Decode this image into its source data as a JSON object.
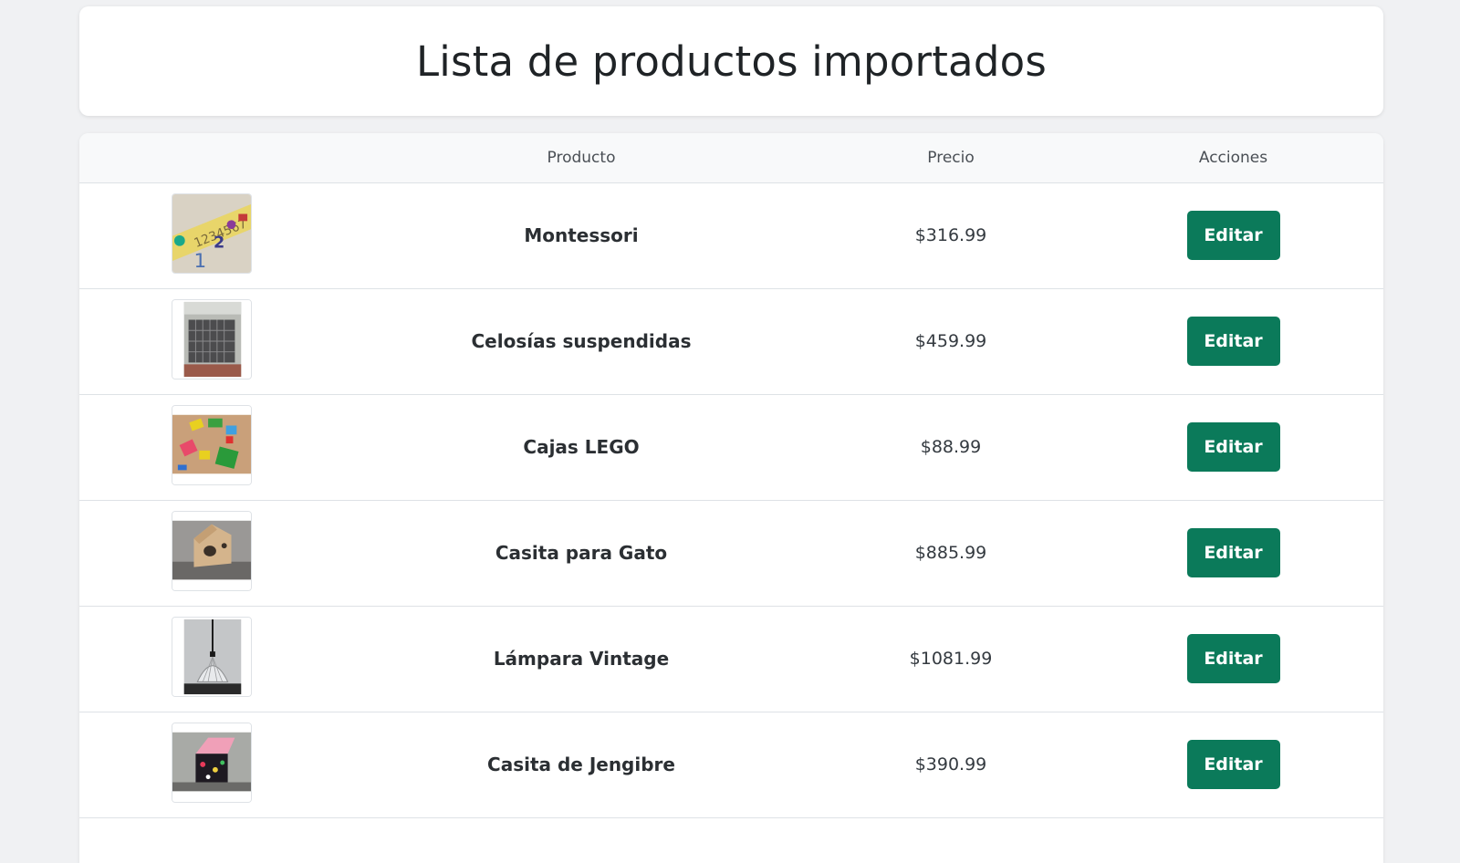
{
  "page": {
    "title": "Lista de productos importados"
  },
  "table": {
    "headers": {
      "image": "",
      "product": "Producto",
      "price": "Precio",
      "actions": "Acciones"
    },
    "rows": [
      {
        "name": "Montessori",
        "price": "$316.99",
        "action_label": "Editar",
        "image_icon": "montessori-numbers-image"
      },
      {
        "name": "Celosías suspendidas",
        "price": "$459.99",
        "action_label": "Editar",
        "image_icon": "hanging-lattice-image"
      },
      {
        "name": "Cajas LEGO",
        "price": "$88.99",
        "action_label": "Editar",
        "image_icon": "lego-boxes-image"
      },
      {
        "name": "Casita para Gato",
        "price": "$885.99",
        "action_label": "Editar",
        "image_icon": "cat-house-image"
      },
      {
        "name": "Lámpara Vintage",
        "price": "$1081.99",
        "action_label": "Editar",
        "image_icon": "vintage-lamp-image"
      },
      {
        "name": "Casita de Jengibre",
        "price": "$390.99",
        "action_label": "Editar",
        "image_icon": "gingerbread-house-image"
      }
    ]
  },
  "colors": {
    "background": "#f0f1f3",
    "card": "#ffffff",
    "accent_button": "#0b7a5a",
    "border": "#dee2e6"
  }
}
